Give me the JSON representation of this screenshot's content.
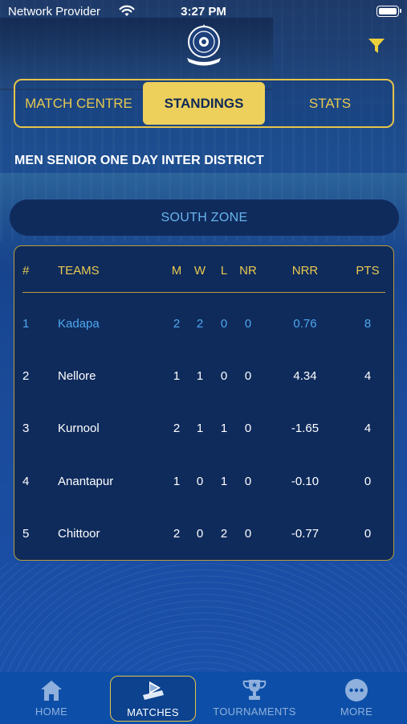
{
  "status_bar": {
    "carrier": "Network Provider",
    "time": "3:27 PM"
  },
  "header": {
    "logo_icon": "association-emblem-icon",
    "filter_icon": "filter-funnel-icon"
  },
  "tabs": [
    {
      "label": "MATCH CENTRE",
      "active": false
    },
    {
      "label": "STANDINGS",
      "active": true
    },
    {
      "label": "STATS",
      "active": false
    }
  ],
  "tournament_title": "MEN SENIOR ONE DAY INTER DISTRICT",
  "zone_label": "SOUTH ZONE",
  "standings": {
    "columns": [
      "#",
      "TEAMS",
      "M",
      "W",
      "L",
      "NR",
      "NRR",
      "PTS"
    ],
    "rows": [
      {
        "rank": "1",
        "team": "Kadapa",
        "m": "2",
        "w": "2",
        "l": "0",
        "nr": "0",
        "nrr": "0.76",
        "pts": "8"
      },
      {
        "rank": "2",
        "team": "Nellore",
        "m": "1",
        "w": "1",
        "l": "0",
        "nr": "0",
        "nrr": "4.34",
        "pts": "4"
      },
      {
        "rank": "3",
        "team": "Kurnool",
        "m": "2",
        "w": "1",
        "l": "1",
        "nr": "0",
        "nrr": "-1.65",
        "pts": "4"
      },
      {
        "rank": "4",
        "team": "Anantapur",
        "m": "1",
        "w": "0",
        "l": "1",
        "nr": "0",
        "nrr": "-0.10",
        "pts": "0"
      },
      {
        "rank": "5",
        "team": "Chittoor",
        "m": "2",
        "w": "0",
        "l": "2",
        "nr": "0",
        "nrr": "-0.77",
        "pts": "0"
      }
    ]
  },
  "bottom_nav": [
    {
      "label": "HOME",
      "icon": "home-icon",
      "active": false
    },
    {
      "label": "MATCHES",
      "icon": "matches-icon",
      "active": true
    },
    {
      "label": "TOURNAMENTS",
      "icon": "trophy-icon",
      "active": false
    },
    {
      "label": "MORE",
      "icon": "more-dots-icon",
      "active": false
    }
  ],
  "colors": {
    "accent_gold": "#edcf5c",
    "highlight_blue": "#4fa7ef",
    "card_bg": "#0f2b5c",
    "tabbar_bg": "#0d4fa8"
  }
}
